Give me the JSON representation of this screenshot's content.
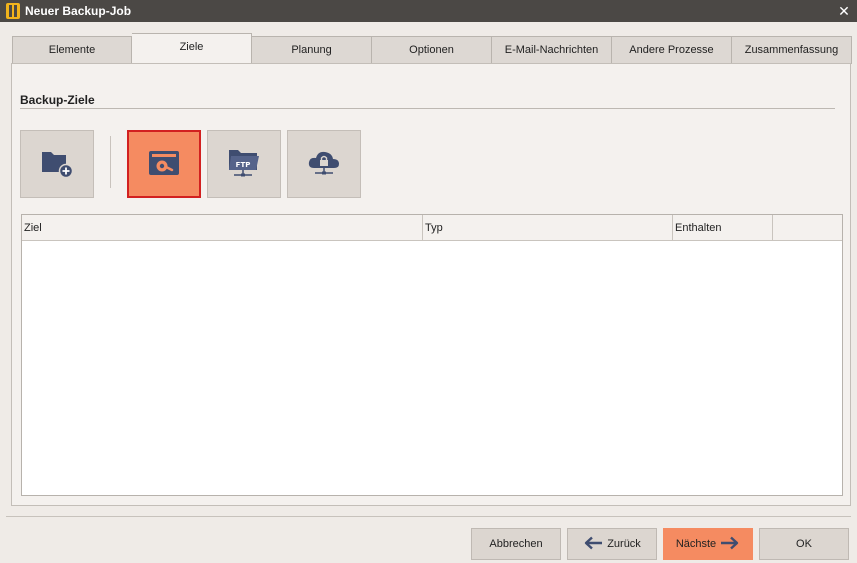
{
  "window": {
    "title": "Neuer Backup-Job",
    "close_glyph": "✕"
  },
  "tabs": [
    {
      "label": "Elemente"
    },
    {
      "label": "Ziele"
    },
    {
      "label": "Planung"
    },
    {
      "label": "Optionen"
    },
    {
      "label": "E-Mail-Nachrichten"
    },
    {
      "label": "Andere Prozesse"
    },
    {
      "label": "Zusammenfassung"
    }
  ],
  "active_tab": "Ziele",
  "section": {
    "title": "Backup-Ziele"
  },
  "destination_buttons": [
    {
      "icon": "folder-add-icon"
    },
    {
      "icon": "local-disk-icon",
      "selected": true
    },
    {
      "icon": "ftp-folder-icon"
    },
    {
      "icon": "cloud-lock-icon"
    }
  ],
  "table": {
    "columns": [
      "Ziel",
      "Typ",
      "Enthalten",
      ""
    ],
    "rows": []
  },
  "buttons": {
    "cancel": "Abbrechen",
    "back": "Zurück",
    "next": "Nächste",
    "ok": "OK"
  },
  "colors": {
    "titlebar": "#4b4845",
    "accent": "#f58b61",
    "selected_border": "#d22020",
    "icon": "#3f4d70"
  }
}
